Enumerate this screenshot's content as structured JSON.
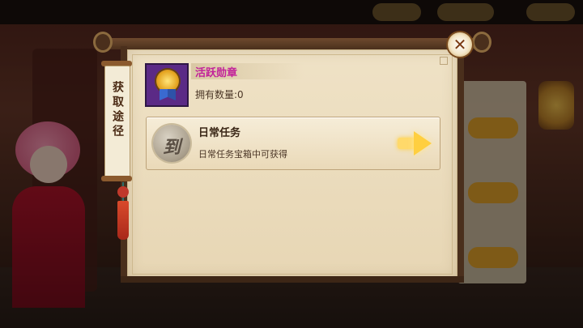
{
  "dialog": {
    "side_banner_label": "获取途径",
    "close_icon": "close-icon"
  },
  "item": {
    "name": "活跃勋章",
    "count_text": "拥有数量:0",
    "icon": "medal-icon",
    "name_color": "#c2219a"
  },
  "sources": [
    {
      "title": "日常任务",
      "description": "日常任务宝箱中可获得",
      "icon": "daily-task-icon",
      "icon_glyph": "到",
      "action_icon": "go-arrow-icon"
    }
  ],
  "colors": {
    "paper": "#efe2c6",
    "frame": "#4a2f1c",
    "accent_gold": "#ffcf40"
  }
}
